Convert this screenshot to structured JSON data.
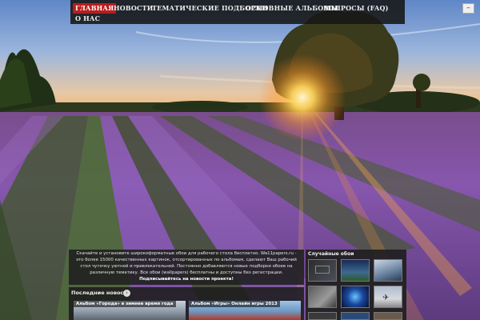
{
  "nav": {
    "items": [
      {
        "label": "ГЛАВНАЯ",
        "active": true
      },
      {
        "label": "НОВОСТИ",
        "active": false
      },
      {
        "label": "ТЕМАТИЧЕСКИЕ ПОДБОРКИ",
        "active": false
      },
      {
        "label": "ОСНОВНЫЕ АЛЬБОМЫ",
        "active": false
      },
      {
        "label": "ВОПРОСЫ (FAQ)",
        "active": false
      },
      {
        "label": "О НАС",
        "active": false
      }
    ],
    "toggle": "–"
  },
  "intro": {
    "text": "Скачайте и установите широкоформатные обои для рабочего стола бесплатно. Wa11papers.ru - это более 15000 качественных картинок, отсортированных по альбомам, сделают Ваш рабочий стол чуточку уютней и привлекательней. Постоянно добавляются новые подборки обоев на различную тематику. Все обои (wallpapers) бесплатны и доступны без регистрации.",
    "cta": "Подписывайтесь на новости проекта!"
  },
  "random": {
    "title": "Случайные обои",
    "thumbs": [
      {
        "icon": "dark-monitor-wallpaper"
      },
      {
        "icon": "night-mountain-wallpaper"
      },
      {
        "icon": "snowy-mountain-wallpaper"
      },
      {
        "icon": "grey-mist-wallpaper"
      },
      {
        "icon": "blue-vortex-wallpaper"
      },
      {
        "icon": "airplane-wallpaper"
      },
      {
        "icon": "dark-wallpaper"
      },
      {
        "icon": "blue-wallpaper"
      },
      {
        "icon": "dusk-wallpaper"
      }
    ]
  },
  "latest": {
    "title": "Последние новости",
    "icon": "arrow-right-icon",
    "albums": [
      {
        "label": "Альбом «Города» в зимнее время года"
      },
      {
        "label": "Альбом «Игры» Онлайн игры 2013"
      }
    ]
  },
  "colors": {
    "accent": "#b81d1d",
    "nav_bg": "#161616",
    "panel_bg": "#202020"
  }
}
